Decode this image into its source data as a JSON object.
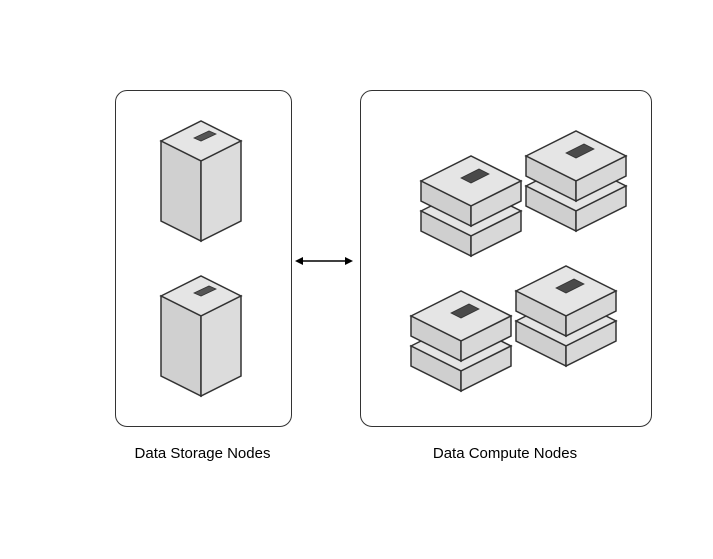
{
  "labels": {
    "storage": "Data Storage Nodes",
    "compute": "Data Compute Nodes"
  }
}
